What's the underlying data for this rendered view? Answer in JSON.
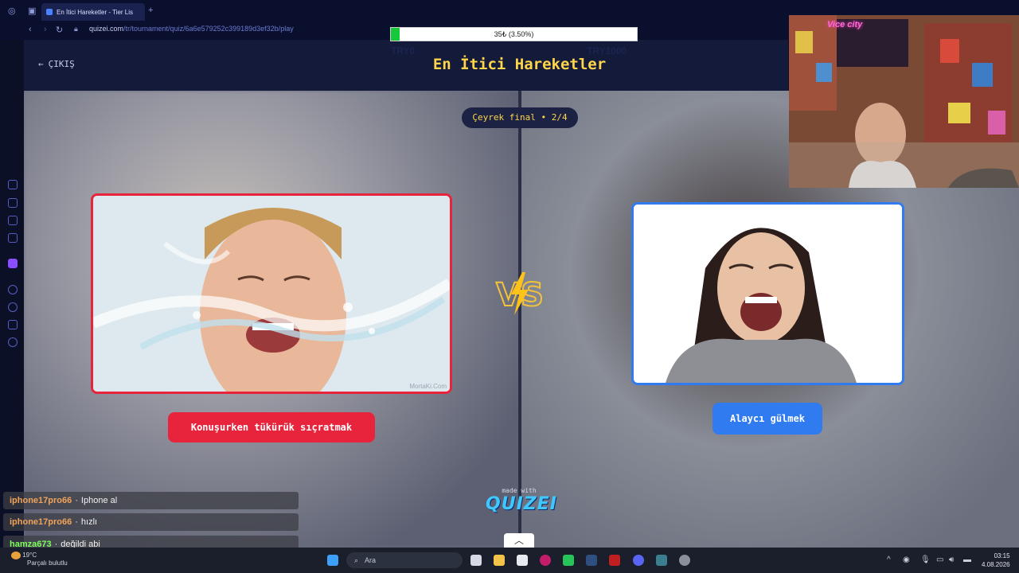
{
  "browser": {
    "tab_title": "En İtici Hareketler - Tier Lis",
    "url_host": "quizei.com",
    "url_path": "/tr/tournament/quiz/6a6e579252c399189d3ef32b/play"
  },
  "donation": {
    "progress_text": "35₺ (3.50%)",
    "progress_fraction": 0.035,
    "min_label": "TRY0",
    "max_label": "TRY1000"
  },
  "quiz": {
    "exit_label": "ÇIKIŞ",
    "title": "En İtici Hareketler",
    "round_label": "Çeyrek final • 2/4",
    "vs_label": "VS",
    "left_option": "Konuşurken tükürük sıçratmak",
    "right_option": "Alaycı gülmek",
    "watermark": "MortaKi.Com",
    "made_with": "made with",
    "brand": "QUIZEI",
    "accent_left": "#e8243c",
    "accent_right": "#2f7bef",
    "title_color": "#ffd54a"
  },
  "webcam": {
    "sign_text": "Vice city"
  },
  "chat": [
    {
      "user": "iphone17pro66",
      "message": "Iphone al",
      "color": "#f1a35a"
    },
    {
      "user": "iphone17pro66",
      "message": "hızlı",
      "color": "#f1a35a"
    },
    {
      "user": "hamza673",
      "message": "değildi abi",
      "color": "#7dff5a"
    }
  ],
  "taskbar": {
    "temperature": "19°C",
    "weather": "Parçalı bulutlu",
    "search_placeholder": "Ara",
    "time": "03:15",
    "date": "4.08.2026"
  }
}
